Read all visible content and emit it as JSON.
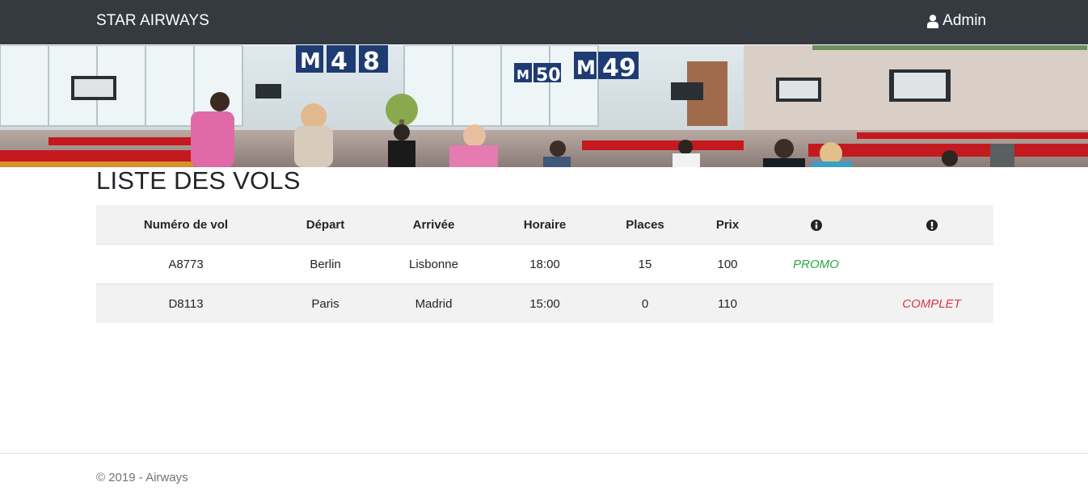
{
  "navbar": {
    "brand": "STAR AIRWAYS",
    "user_label": "Admin",
    "background": "#343a40"
  },
  "banner": {
    "gate_signs": [
      "M",
      "48",
      "M",
      "50",
      "M",
      "49"
    ]
  },
  "page": {
    "title": "LISTE DES VOLS"
  },
  "table": {
    "headers": [
      "Numéro de vol",
      "Départ",
      "Arrivée",
      "Horaire",
      "Places",
      "Prix"
    ],
    "info_icon": "info-circle-icon",
    "warning_icon": "exclamation-circle-icon",
    "rows": [
      {
        "numero": "A8773",
        "depart": "Berlin",
        "arrivee": "Lisbonne",
        "horaire": "18:00",
        "places": "15",
        "prix": "100",
        "info": "PROMO",
        "alert": ""
      },
      {
        "numero": "D8113",
        "depart": "Paris",
        "arrivee": "Madrid",
        "horaire": "15:00",
        "places": "0",
        "prix": "110",
        "info": "",
        "alert": "COMPLET"
      }
    ]
  },
  "footer": {
    "text": "© 2019 - Airways"
  },
  "colors": {
    "promo": "#28a745",
    "complet": "#dc3545"
  }
}
